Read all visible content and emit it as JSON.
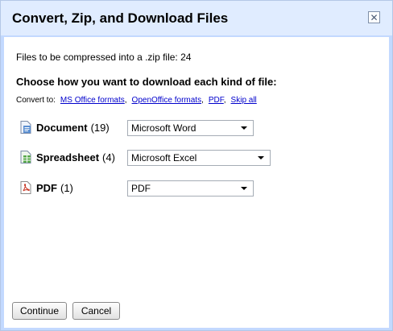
{
  "dialog": {
    "title": "Convert, Zip, and Download Files",
    "close_glyph": "✕"
  },
  "info": {
    "compress_line": "Files to be compressed into a .zip file: 24"
  },
  "choose_heading": "Choose how you want to download each kind of file:",
  "convert": {
    "label": "Convert to:",
    "links": [
      {
        "label": "MS Office formats",
        "sep": ","
      },
      {
        "label": "OpenOffice formats",
        "sep": ","
      },
      {
        "label": "PDF",
        "sep": ","
      },
      {
        "label": "Skip all",
        "sep": ""
      }
    ]
  },
  "file_types": [
    {
      "name": "Document",
      "count": "(19)",
      "selected": "Microsoft Word",
      "icon": "document-icon",
      "icon_color": "#5b8fd1"
    },
    {
      "name": "Spreadsheet",
      "count": "(4)",
      "selected": "Microsoft Excel",
      "icon": "spreadsheet-icon",
      "icon_color": "#57a84a"
    },
    {
      "name": "PDF",
      "count": "(1)",
      "selected": "PDF",
      "icon": "pdf-icon",
      "icon_color": "#c8321f"
    }
  ],
  "buttons": {
    "continue": "Continue",
    "cancel": "Cancel"
  }
}
